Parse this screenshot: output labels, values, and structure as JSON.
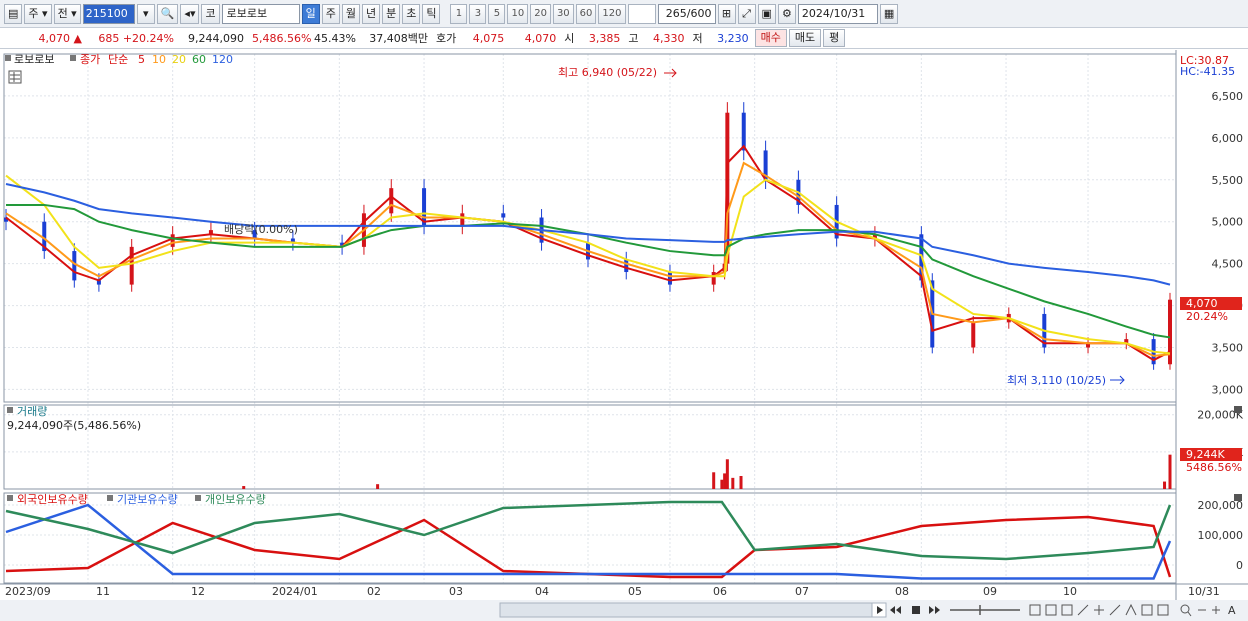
{
  "toolbar": {
    "market": "주",
    "prev": "전",
    "code": "215100",
    "name": "로보로보",
    "co_label": "코",
    "periods": [
      "일",
      "주",
      "월",
      "년",
      "분",
      "초",
      "틱"
    ],
    "intervals": [
      "1",
      "3",
      "5",
      "10",
      "20",
      "30",
      "60",
      "120"
    ],
    "count": "265/600",
    "date": "2024/10/31"
  },
  "quote": {
    "price": "4,070",
    "change": "685",
    "change_pct": "+20.24%",
    "volume": "9,244,090",
    "volume_ratio": "5,486.56%",
    "turnover": "45.43%",
    "amount": "37,408백만",
    "bid_label": "호가",
    "bid1": "4,075",
    "bid2": "4,070",
    "open_label": "시",
    "open": "3,385",
    "high_label": "고",
    "high": "4,330",
    "low_label": "저",
    "low": "3,230",
    "buy": "매수",
    "sell": "매도",
    "eval": "평"
  },
  "legend": {
    "stock": "로보로보",
    "close": "종가",
    "simple": "단순",
    "ma": [
      "5",
      "10",
      "20",
      "60",
      "120"
    ]
  },
  "colors": {
    "up": "#d4141a",
    "down": "#1a3fd4",
    "ma5": "#d81010",
    "ma10": "#ff9a1a",
    "ma20": "#f2e21a",
    "ma60": "#22993a",
    "ma120": "#2b5fe0",
    "foreign": "#d81010",
    "inst": "#2b5fe0",
    "indiv": "#2e8a5a"
  },
  "price_panel": {
    "lc": "LC:30.87",
    "hc": "HC:-41.35",
    "last": "4,070",
    "last_pct": "20.24%",
    "high_note": "최고 6,940 (05/22)",
    "low_note": "최저 3,110 (10/25)",
    "dividend_note": "배당락(0.00%)"
  },
  "volume_panel": {
    "title": "거래량",
    "info": "9,244,090주(5,486.56%)",
    "tag": "9,244K",
    "tag_pct": "5486.56%"
  },
  "holding_panel": {
    "series": [
      "외국인보유수량",
      "기관보유수량",
      "개인보유수량"
    ]
  },
  "date_labels": [
    "2023/09",
    "11",
    "12",
    "2024/01",
    "02",
    "03",
    "04",
    "05",
    "06",
    "07",
    "08",
    "09",
    "10",
    "10/31"
  ],
  "chart_data": [
    {
      "type": "candlestick",
      "title": "로보로보",
      "ylim": [
        2850,
        7000
      ],
      "y_ticks": [
        3000,
        3500,
        4000,
        4500,
        5000,
        5500,
        6000,
        6500
      ],
      "y_tick_labels": [
        "3,000",
        "3,500",
        "4,000",
        "4,500",
        "5,000",
        "5,500",
        "6,000",
        "6,500"
      ],
      "x": [
        "2023-09-01",
        "2023-09-15",
        "2023-09-26",
        "2023-10-05",
        "2023-10-17",
        "2023-11-01",
        "2023-11-15",
        "2023-12-01",
        "2023-12-15",
        "2024-01-02",
        "2024-01-10",
        "2024-01-20",
        "2024-02-01",
        "2024-02-15",
        "2024-03-01",
        "2024-03-15",
        "2024-04-01",
        "2024-04-15",
        "2024-05-01",
        "2024-05-17",
        "2024-05-21",
        "2024-05-22",
        "2024-05-28",
        "2024-06-05",
        "2024-06-17",
        "2024-07-01",
        "2024-07-15",
        "2024-08-01",
        "2024-08-05",
        "2024-08-20",
        "2024-09-02",
        "2024-09-15",
        "2024-10-01",
        "2024-10-15",
        "2024-10-25",
        "2024-10-31"
      ],
      "series": [
        {
          "name": "종가",
          "values": [
            5000,
            4650,
            4300,
            4250,
            4700,
            4850,
            4900,
            4800,
            4750,
            4700,
            5100,
            5400,
            4950,
            5100,
            5050,
            4750,
            4550,
            4400,
            4250,
            4400,
            4500,
            6300,
            5850,
            5500,
            5200,
            4800,
            4850,
            4300,
            3500,
            3800,
            3900,
            3500,
            3550,
            3600,
            3300,
            4070
          ]
        },
        {
          "name": "5",
          "values": [
            5050,
            4700,
            4400,
            4300,
            4600,
            4800,
            4850,
            4800,
            4750,
            4700,
            5000,
            5300,
            5000,
            5050,
            5000,
            4800,
            4600,
            4450,
            4300,
            4350,
            4450,
            5700,
            5900,
            5500,
            5250,
            4850,
            4800,
            4350,
            3700,
            3850,
            3850,
            3550,
            3550,
            3550,
            3350,
            3450
          ]
        },
        {
          "name": "10",
          "values": [
            5100,
            4800,
            4500,
            4350,
            4550,
            4750,
            4800,
            4800,
            4750,
            4700,
            4900,
            5200,
            5050,
            5050,
            5000,
            4850,
            4650,
            4500,
            4350,
            4350,
            4400,
            5100,
            5700,
            5550,
            5300,
            4900,
            4800,
            4450,
            3900,
            3800,
            3850,
            3600,
            3550,
            3550,
            3400,
            3420
          ]
        },
        {
          "name": "20",
          "values": [
            5550,
            5200,
            4700,
            4450,
            4500,
            4650,
            4750,
            4750,
            4750,
            4700,
            4800,
            5050,
            5100,
            5050,
            5000,
            4900,
            4750,
            4550,
            4400,
            4350,
            4350,
            4600,
            5300,
            5500,
            5350,
            5000,
            4800,
            4600,
            4200,
            3900,
            3850,
            3700,
            3600,
            3550,
            3450,
            3430
          ]
        },
        {
          "name": "60",
          "values": [
            5200,
            5200,
            5150,
            5000,
            4900,
            4800,
            4750,
            4700,
            4700,
            4700,
            4800,
            4900,
            4950,
            4950,
            4980,
            4950,
            4850,
            4750,
            4650,
            4600,
            4600,
            4700,
            4800,
            4850,
            4900,
            4900,
            4850,
            4700,
            4550,
            4350,
            4200,
            4050,
            3900,
            3750,
            3650,
            3620
          ]
        },
        {
          "name": "120",
          "values": [
            5450,
            5350,
            5250,
            5150,
            5100,
            5050,
            5000,
            4950,
            4950,
            4950,
            4950,
            4950,
            4950,
            4950,
            4950,
            4900,
            4850,
            4800,
            4780,
            4760,
            4760,
            4780,
            4800,
            4820,
            4850,
            4880,
            4880,
            4800,
            4700,
            4600,
            4500,
            4450,
            4400,
            4350,
            4300,
            4250
          ]
        }
      ]
    },
    {
      "type": "bar",
      "title": "거래량",
      "ylim": [
        0,
        21000000
      ],
      "y_ticks": [
        10000000,
        20000000
      ],
      "y_tick_labels": [
        "10,000K",
        "20,000K"
      ],
      "x": [
        "2023-11-27",
        "2024-01-15",
        "2024-05-17",
        "2024-05-20",
        "2024-05-21",
        "2024-05-22",
        "2024-05-24",
        "2024-05-27",
        "2024-10-29",
        "2024-10-31"
      ],
      "values": [
        800000,
        1300000,
        4500000,
        2500000,
        4200000,
        8000000,
        3000000,
        3500000,
        2000000,
        9244090
      ]
    },
    {
      "type": "line",
      "title": "외국인보유수량 / 기관보유수량 / 개인보유수량",
      "ylim": [
        -60000,
        240000
      ],
      "y_ticks": [
        0,
        100000,
        200000
      ],
      "y_tick_labels": [
        "0",
        "100,000",
        "200,000"
      ],
      "x": [
        "2023-09-01",
        "2023-10-01",
        "2023-11-01",
        "2023-12-01",
        "2024-01-01",
        "2024-02-01",
        "2024-03-01",
        "2024-04-01",
        "2024-05-01",
        "2024-05-20",
        "2024-06-01",
        "2024-07-01",
        "2024-08-01",
        "2024-09-01",
        "2024-10-01",
        "2024-10-25",
        "2024-10-31"
      ],
      "series": [
        {
          "name": "외국인보유수량",
          "values": [
            -20000,
            -10000,
            140000,
            50000,
            20000,
            150000,
            -20000,
            -30000,
            -40000,
            -40000,
            50000,
            60000,
            130000,
            150000,
            160000,
            130000,
            -40000
          ]
        },
        {
          "name": "기관보유수량",
          "values": [
            110000,
            200000,
            -30000,
            -30000,
            -30000,
            -30000,
            -30000,
            -30000,
            -30000,
            -30000,
            -30000,
            -30000,
            -45000,
            -45000,
            -45000,
            -45000,
            80000
          ]
        },
        {
          "name": "개인보유수량",
          "values": [
            180000,
            120000,
            40000,
            140000,
            170000,
            100000,
            190000,
            200000,
            210000,
            210000,
            50000,
            70000,
            30000,
            20000,
            40000,
            60000,
            200000
          ]
        }
      ]
    }
  ]
}
